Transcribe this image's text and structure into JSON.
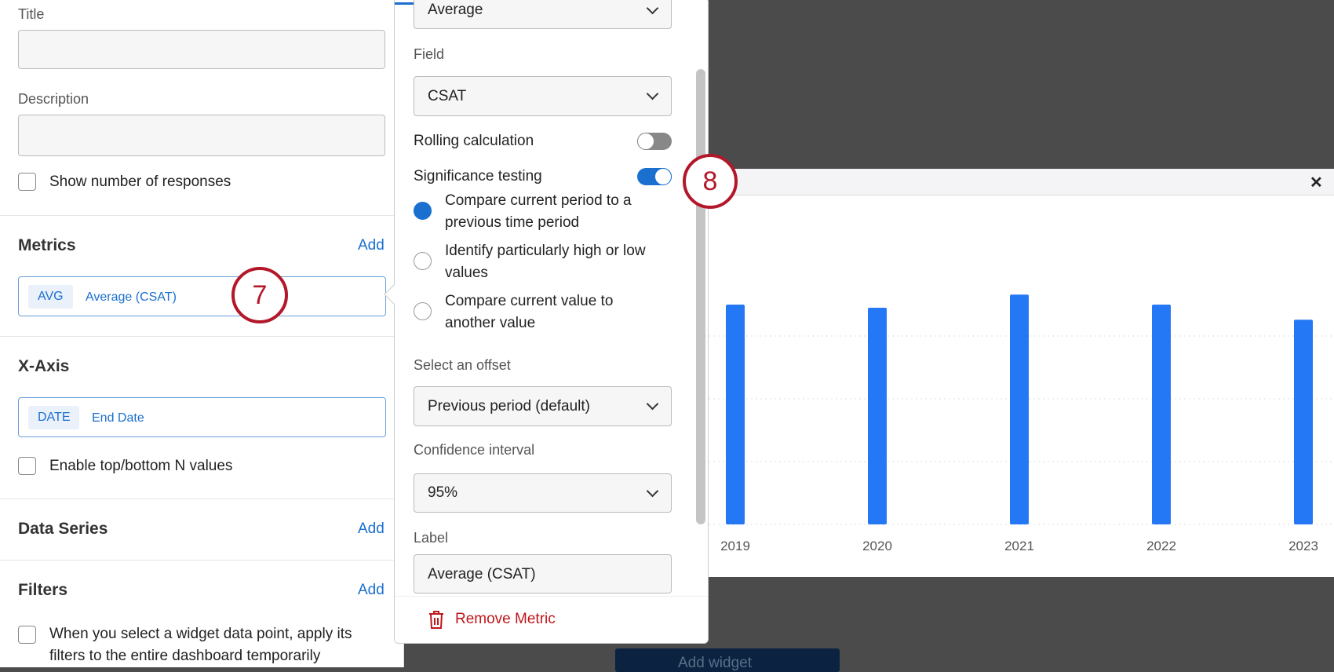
{
  "left": {
    "title_label": "Title",
    "description_label": "Description",
    "show_responses": "Show number of responses",
    "metrics": {
      "heading": "Metrics",
      "add": "Add",
      "tag": "AVG",
      "value": "Average (CSAT)"
    },
    "xaxis": {
      "heading": "X-Axis",
      "tag": "DATE",
      "value": "End Date",
      "topn": "Enable top/bottom N values"
    },
    "data_series": {
      "heading": "Data Series",
      "add": "Add"
    },
    "filters": {
      "heading": "Filters",
      "add": "Add",
      "apply_line1": "When you select a widget data point, apply its",
      "apply_line2": "filters to the entire dashboard temporarily"
    }
  },
  "annotations": {
    "a7": "7",
    "a8": "8"
  },
  "popover": {
    "calc_value": "Average",
    "field_label": "Field",
    "field_value": "CSAT",
    "rolling_label": "Rolling calculation",
    "rolling_on": false,
    "sig_label": "Significance testing",
    "sig_on": true,
    "options": [
      {
        "l1": "Compare current period to a",
        "l2": "previous time period",
        "selected": true
      },
      {
        "l1": "Identify particularly high or low",
        "l2": "values",
        "selected": false
      },
      {
        "l1": "Compare current value to",
        "l2": "another value",
        "selected": false
      }
    ],
    "offset_label": "Select an offset",
    "offset_value": "Previous period (default)",
    "ci_label": "Confidence interval",
    "ci_value": "95%",
    "label_label": "Label",
    "label_value": "Average (CSAT)",
    "remove": "Remove Metric"
  },
  "widget": {
    "close": "✕",
    "add_widget": "Add widget"
  },
  "colors": {
    "accent": "#1a6fcf",
    "bar": "#2478f5",
    "annotation": "#b3172a",
    "danger": "#c0161c"
  },
  "chart_data": {
    "type": "bar",
    "categories": [
      "2019",
      "2020",
      "2021",
      "2022",
      "2023"
    ],
    "values": [
      3.5,
      3.45,
      3.66,
      3.5,
      3.26
    ],
    "ylim": [
      0,
      5
    ],
    "grid": true,
    "title": "",
    "xlabel": "",
    "ylabel": ""
  }
}
